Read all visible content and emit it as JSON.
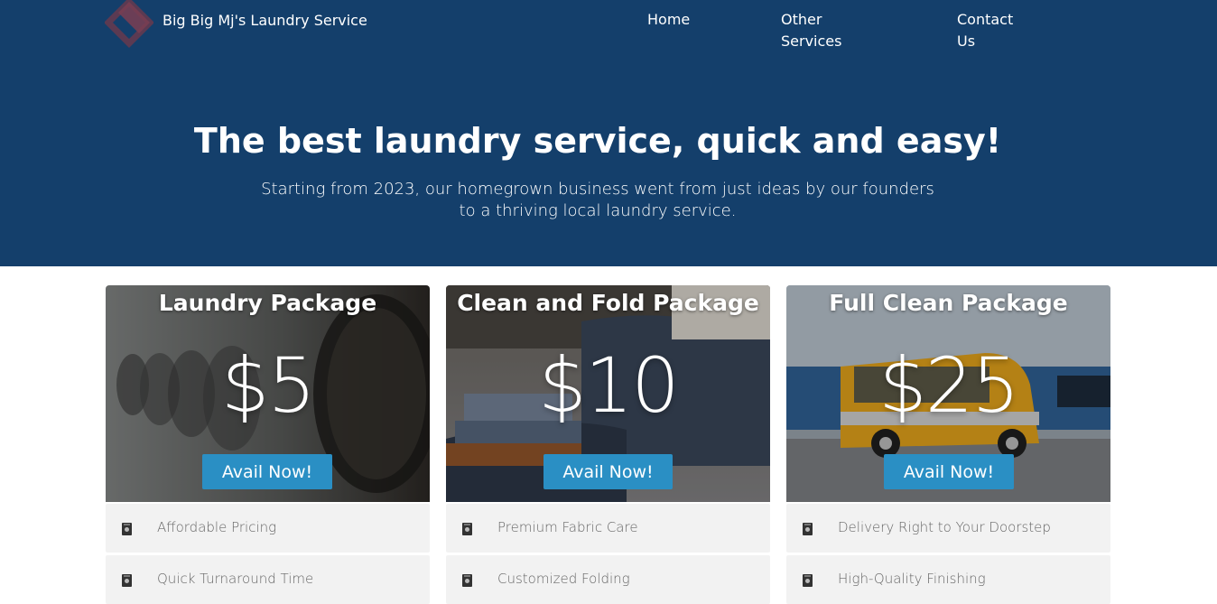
{
  "header": {
    "brand": "Big Big Mj's Laundry Service",
    "logo_icon": "diamond-logo-icon",
    "nav": {
      "home": "Home",
      "other_services": "Other Services",
      "contact_us": "Contact Us"
    }
  },
  "hero": {
    "title": "The best laundry service, quick and easy!",
    "subtitle": "Starting from 2023, our homegrown business went from just ideas by our founders to a thriving local laundry service."
  },
  "colors": {
    "hero_bg": "#143f6b",
    "button": "#2a8fc4",
    "feature_bg": "#f2f2f2"
  },
  "packages": [
    {
      "title": "Laundry Package",
      "price": "$5",
      "button": "Avail Now!",
      "features": [
        "Affordable Pricing",
        "Quick Turnaround Time"
      ]
    },
    {
      "title": "Clean and Fold Package",
      "price": "$10",
      "button": "Avail Now!",
      "features": [
        "Premium Fabric Care",
        "Customized Folding"
      ]
    },
    {
      "title": "Full Clean Package",
      "price": "$25",
      "button": "Avail Now!",
      "features": [
        "Delivery Right to Your Doorstep",
        "High-Quality Finishing"
      ]
    }
  ],
  "feature_icon": "washing-machine-icon"
}
